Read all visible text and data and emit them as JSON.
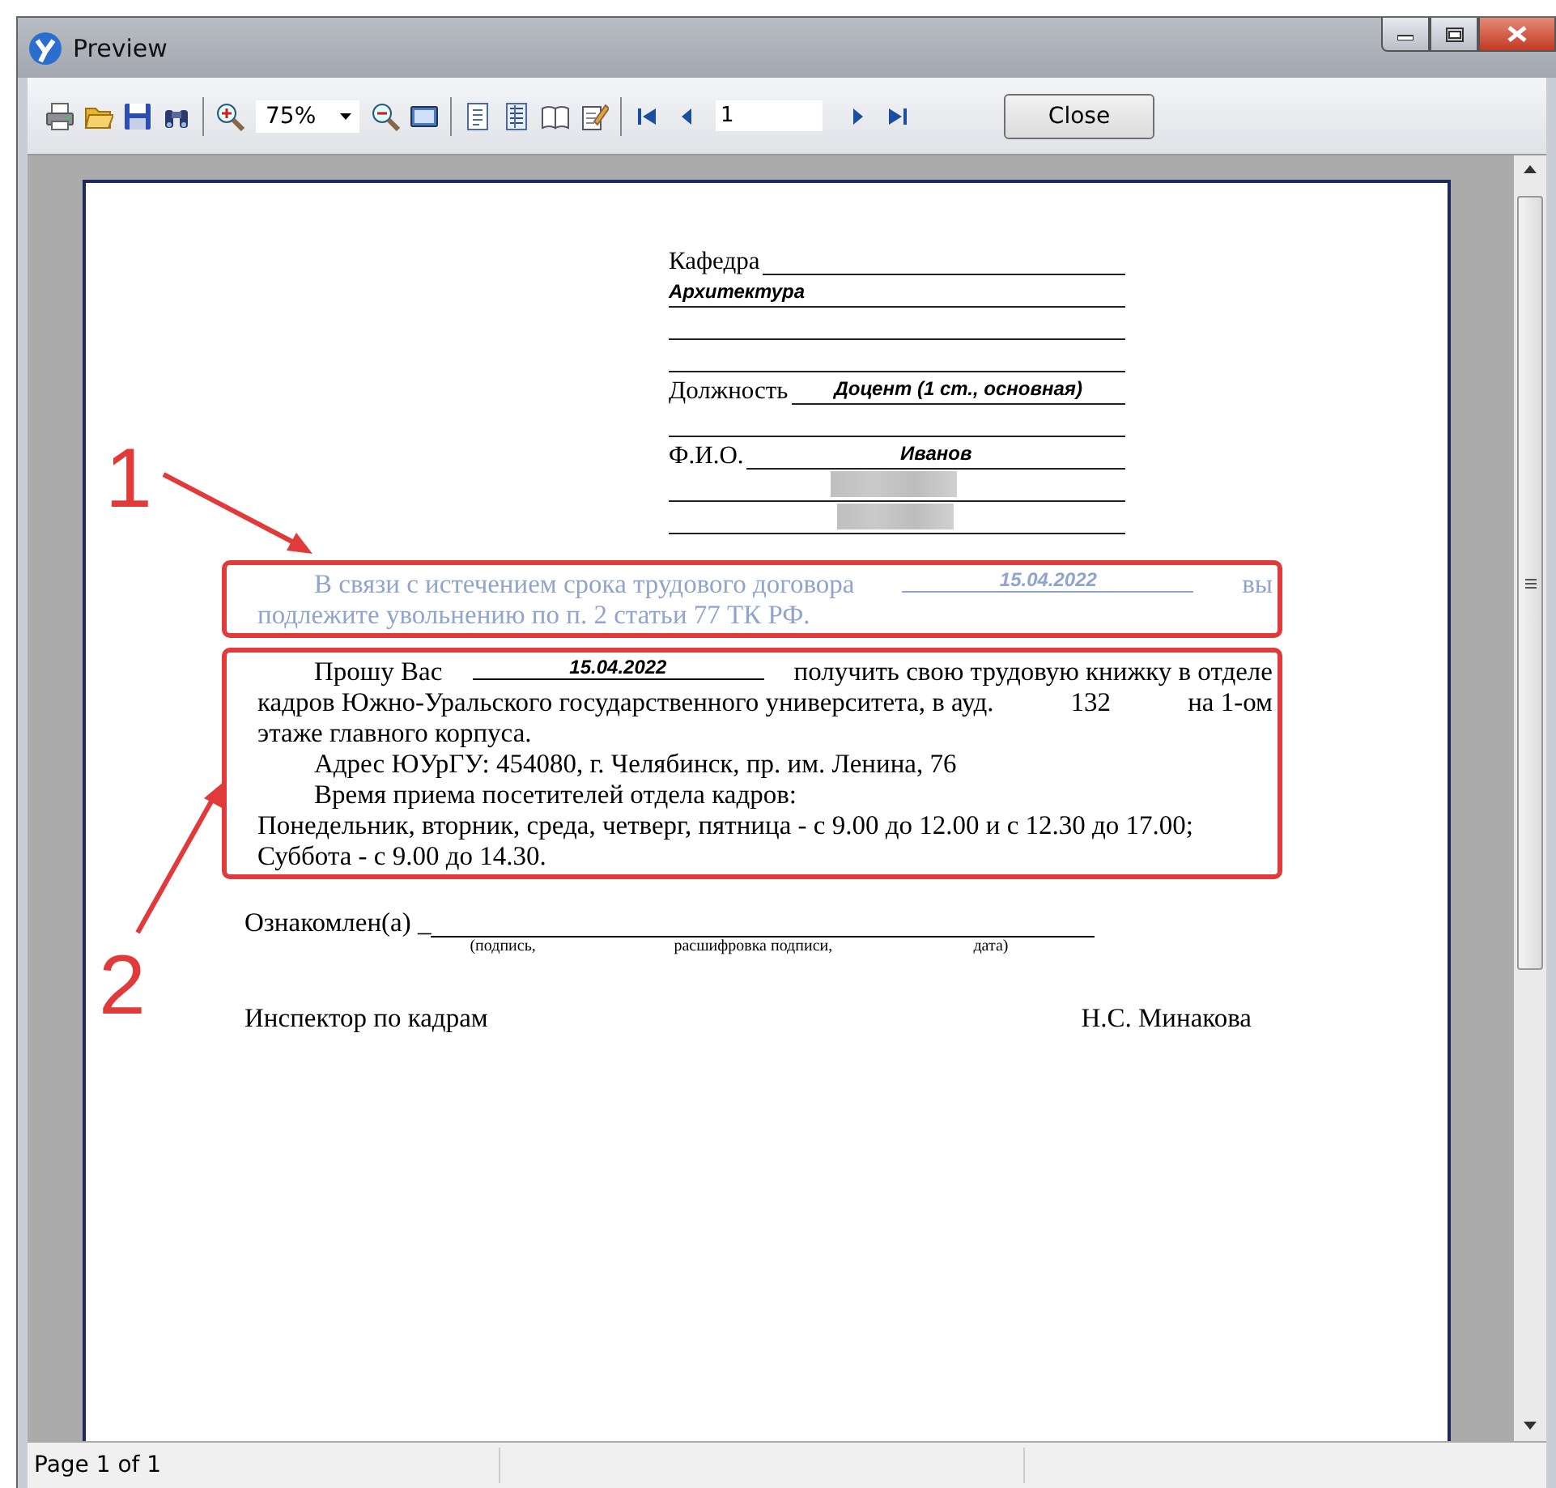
{
  "window": {
    "title": "Preview"
  },
  "toolbar": {
    "zoom": "75%",
    "page_number": "1",
    "close_button": "Close"
  },
  "document": {
    "header_rows": [
      {
        "kind": "label",
        "label": "Кафедра"
      },
      {
        "kind": "value",
        "value": "Архитектура"
      },
      {
        "kind": "blank"
      },
      {
        "kind": "blank"
      },
      {
        "kind": "label",
        "label": "Должность",
        "value": "Доцент  (1 ст., основная)"
      },
      {
        "kind": "blank"
      },
      {
        "kind": "label",
        "label": "Ф.И.О.",
        "value": "Иванов"
      },
      {
        "kind": "redacted"
      },
      {
        "kind": "redacted"
      }
    ],
    "dismissal_notice": {
      "faded": true,
      "lines": [
        {
          "kind": "indented",
          "segments": [
            {
              "kind": "text",
              "text": "В связи с истечением срока трудового договора"
            },
            {
              "kind": "date",
              "text": "15.04.2022"
            },
            {
              "kind": "text",
              "text": "вы"
            }
          ]
        },
        {
          "kind": "plain",
          "segments": [
            {
              "kind": "text",
              "text": "подлежите увольнению по п. 2 статьи 77 ТК РФ."
            }
          ]
        }
      ]
    },
    "pickup_notice": {
      "faded": false,
      "lines": [
        {
          "kind": "indented",
          "segments": [
            {
              "kind": "text",
              "text": "Прошу Вас"
            },
            {
              "kind": "date",
              "text": "15.04.2022"
            },
            {
              "kind": "text",
              "text": "получить свою трудовую книжку в отделе"
            }
          ]
        },
        {
          "kind": "plain",
          "segments": [
            {
              "kind": "text",
              "text": "кадров Южно-Уральского государственного университета, в ауд."
            },
            {
              "kind": "room",
              "text": "132"
            },
            {
              "kind": "text",
              "text": "на 1-ом"
            }
          ]
        },
        {
          "kind": "plain",
          "segments": [
            {
              "kind": "text",
              "text": "этаже главного корпуса."
            }
          ]
        },
        {
          "kind": "indented",
          "segments": [
            {
              "kind": "text",
              "text": "Адрес ЮУрГУ: 454080, г. Челябинск, пр. им. Ленина, 76"
            }
          ]
        },
        {
          "kind": "indented",
          "segments": [
            {
              "kind": "text",
              "text": "Время приема посетителей отдела кадров:"
            }
          ]
        },
        {
          "kind": "plain",
          "segments": [
            {
              "kind": "text",
              "text": "Понедельник, вторник, среда, четверг, пятница - с 9.00 до 12.00 и с 12.30 до 17.00;"
            }
          ]
        },
        {
          "kind": "plain",
          "segments": [
            {
              "kind": "text",
              "text": "Суббота - с 9.00 до 14.30."
            }
          ]
        }
      ]
    },
    "acknowledgement": {
      "label": "Ознакомлен(а) _",
      "captions": [
        "(подпись,",
        "расшифровка подписи,",
        "дата)"
      ]
    },
    "inspector": {
      "title": "Инспектор по кадрам",
      "name": "Н.С. Минакова"
    }
  },
  "annotations": [
    {
      "number": "1"
    },
    {
      "number": "2"
    }
  ],
  "status_bar": {
    "text": "Page 1 of 1"
  }
}
